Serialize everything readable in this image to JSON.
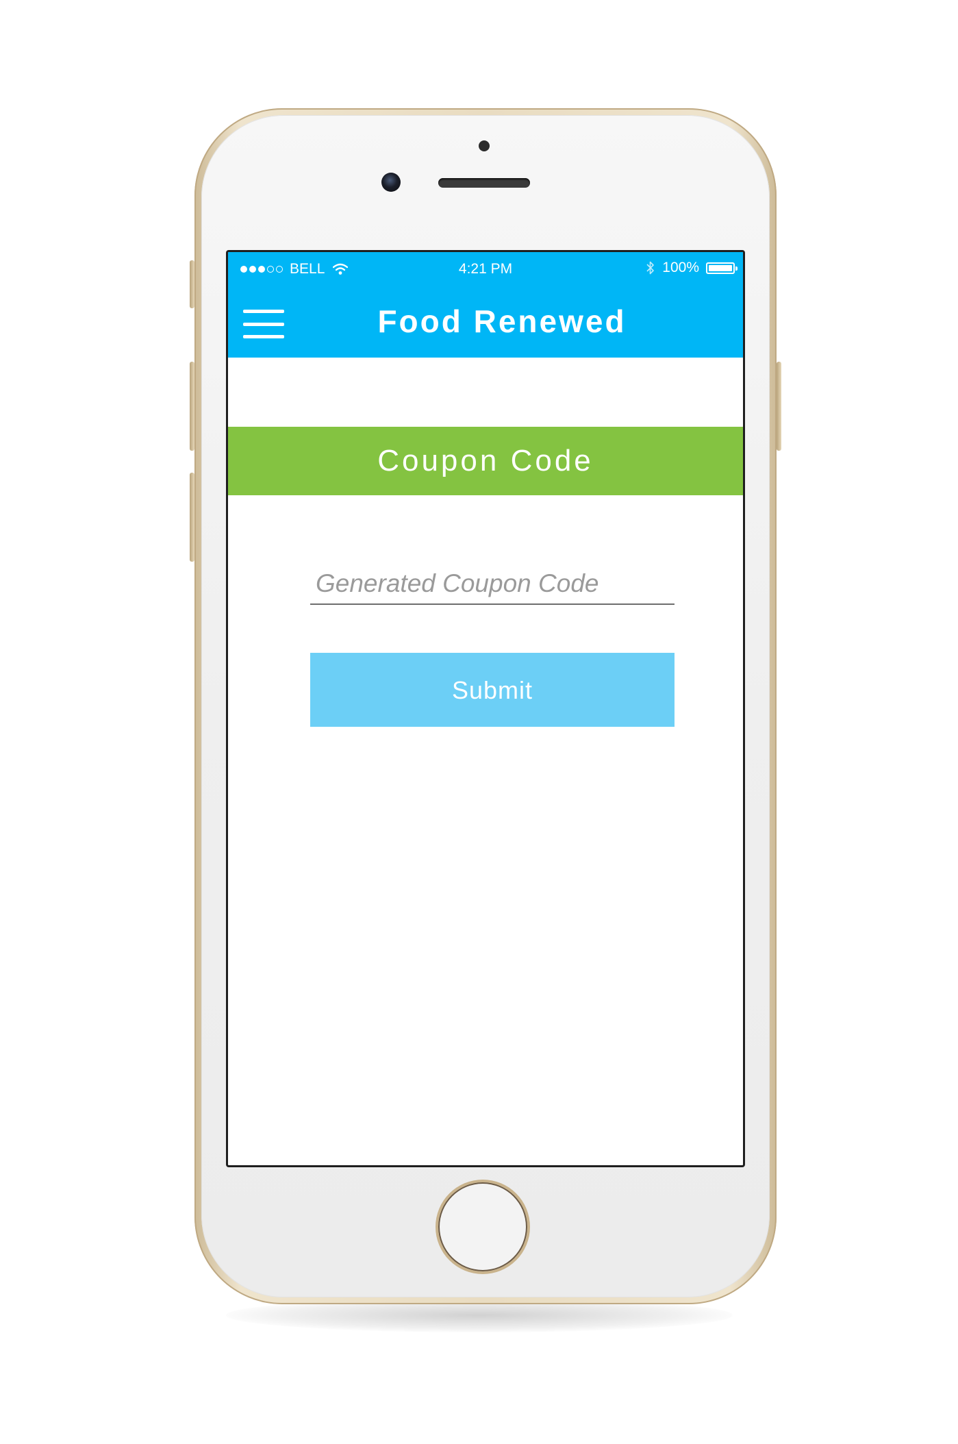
{
  "status_bar": {
    "carrier": "BELL",
    "time": "4:21 PM",
    "battery": "100%",
    "signal_bars_filled": 3,
    "signal_bars_total": 5,
    "icons": [
      "signal-dots-icon",
      "wifi-icon",
      "bluetooth-icon",
      "battery-icon"
    ]
  },
  "header": {
    "title": "Food Renewed",
    "menu_icon": "hamburger-menu-icon",
    "background_color": "#00b6f6"
  },
  "section": {
    "title": "Coupon Code",
    "background_color": "#84c341"
  },
  "form": {
    "coupon_placeholder": "Generated Coupon Code",
    "coupon_value": "",
    "submit_label": "Submit",
    "submit_color": "#6ccff6"
  },
  "device": {
    "icons": [
      "front-camera-icon",
      "earpiece-speaker-icon",
      "home-button-icon"
    ]
  }
}
